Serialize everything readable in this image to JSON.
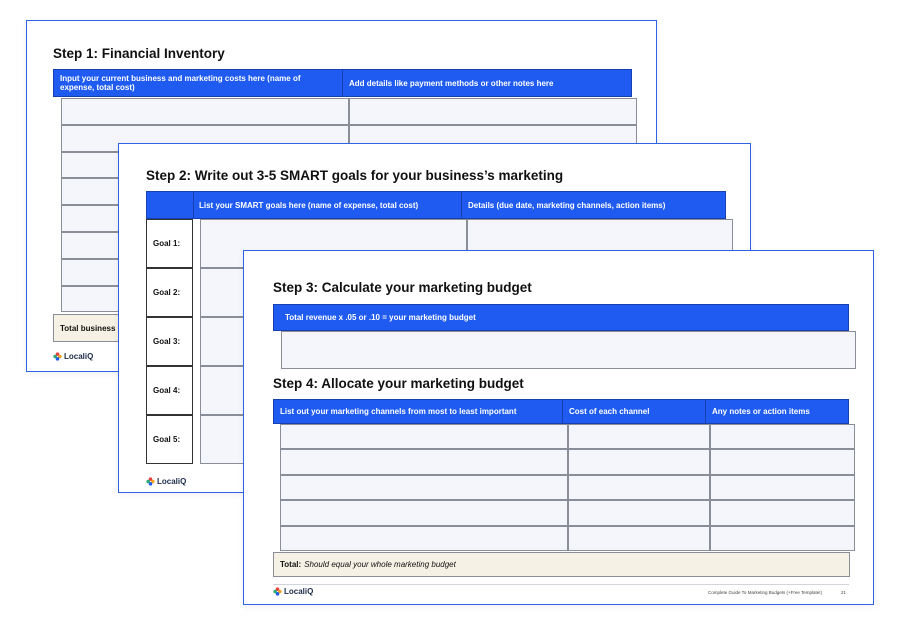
{
  "slide1": {
    "title": "Step 1: Financial Inventory",
    "header_col1": "Input your current business and marketing costs here (name of expense, total cost)",
    "header_col2": "Add details like payment methods or other notes here",
    "total_label": "Total business",
    "logo_text": "LocaliQ"
  },
  "slide2": {
    "title": "Step 2: Write out 3-5 SMART goals for your business’s marketing",
    "header_col1": "List your SMART goals here (name of expense, total cost)",
    "header_col2": "Details (due date, marketing channels, action items)",
    "goals": [
      "Goal 1:",
      "Goal 2:",
      "Goal 3:",
      "Goal 4:",
      "Goal 5:"
    ],
    "logo_text": "LocaliQ"
  },
  "slide3": {
    "step3_title": "Step 3: Calculate your marketing budget",
    "step3_header": "Total revenue x .05 or .10 = your marketing budget",
    "step4_title": "Step 4: Allocate your marketing budget",
    "step4_header_col1": "List out your marketing channels from most to least important",
    "step4_header_col2": "Cost of each channel",
    "step4_header_col3": "Any notes or action items",
    "total_bold": "Total:",
    "total_italic": "Should equal your whole marketing budget",
    "logo_text": "LocaliQ",
    "footer_text": "Complete Guide To Marketing Budgets (+Free Template!)",
    "page_number": "21"
  },
  "colors": {
    "header_blue": "#1f5bf1",
    "cell_fill": "#f4f6fc",
    "total_fill": "#f5f1e4",
    "slide_border": "#2f63e6"
  },
  "icons": {
    "logo": "localiq-flower-icon"
  }
}
